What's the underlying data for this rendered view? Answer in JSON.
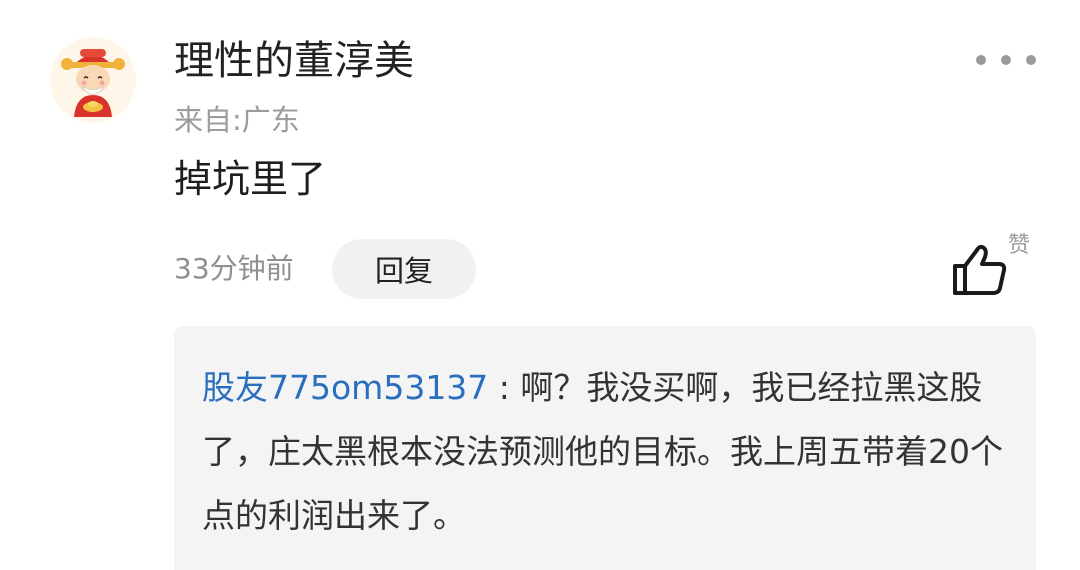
{
  "comment": {
    "avatar_icon": "god-of-wealth-avatar-icon",
    "username": "理性的董淳美",
    "location": "来自:广东",
    "text": "掉坑里了",
    "time": "33分钟前",
    "reply_label": "回复",
    "like_label": "赞",
    "like_icon": "thumbs-up-icon",
    "more_icon": "more-dots-icon"
  },
  "reply": {
    "user": "股友775om53137",
    "separator": " : ",
    "text": "啊？我没买啊，我已经拉黑这股了，庄太黑根本没法预测他的目标。我上周五带着20个点的利润出来了。"
  },
  "colors": {
    "link_blue": "#2a6fbe",
    "reply_bg": "#f4f4f4",
    "muted_text": "#9c9c9c"
  }
}
